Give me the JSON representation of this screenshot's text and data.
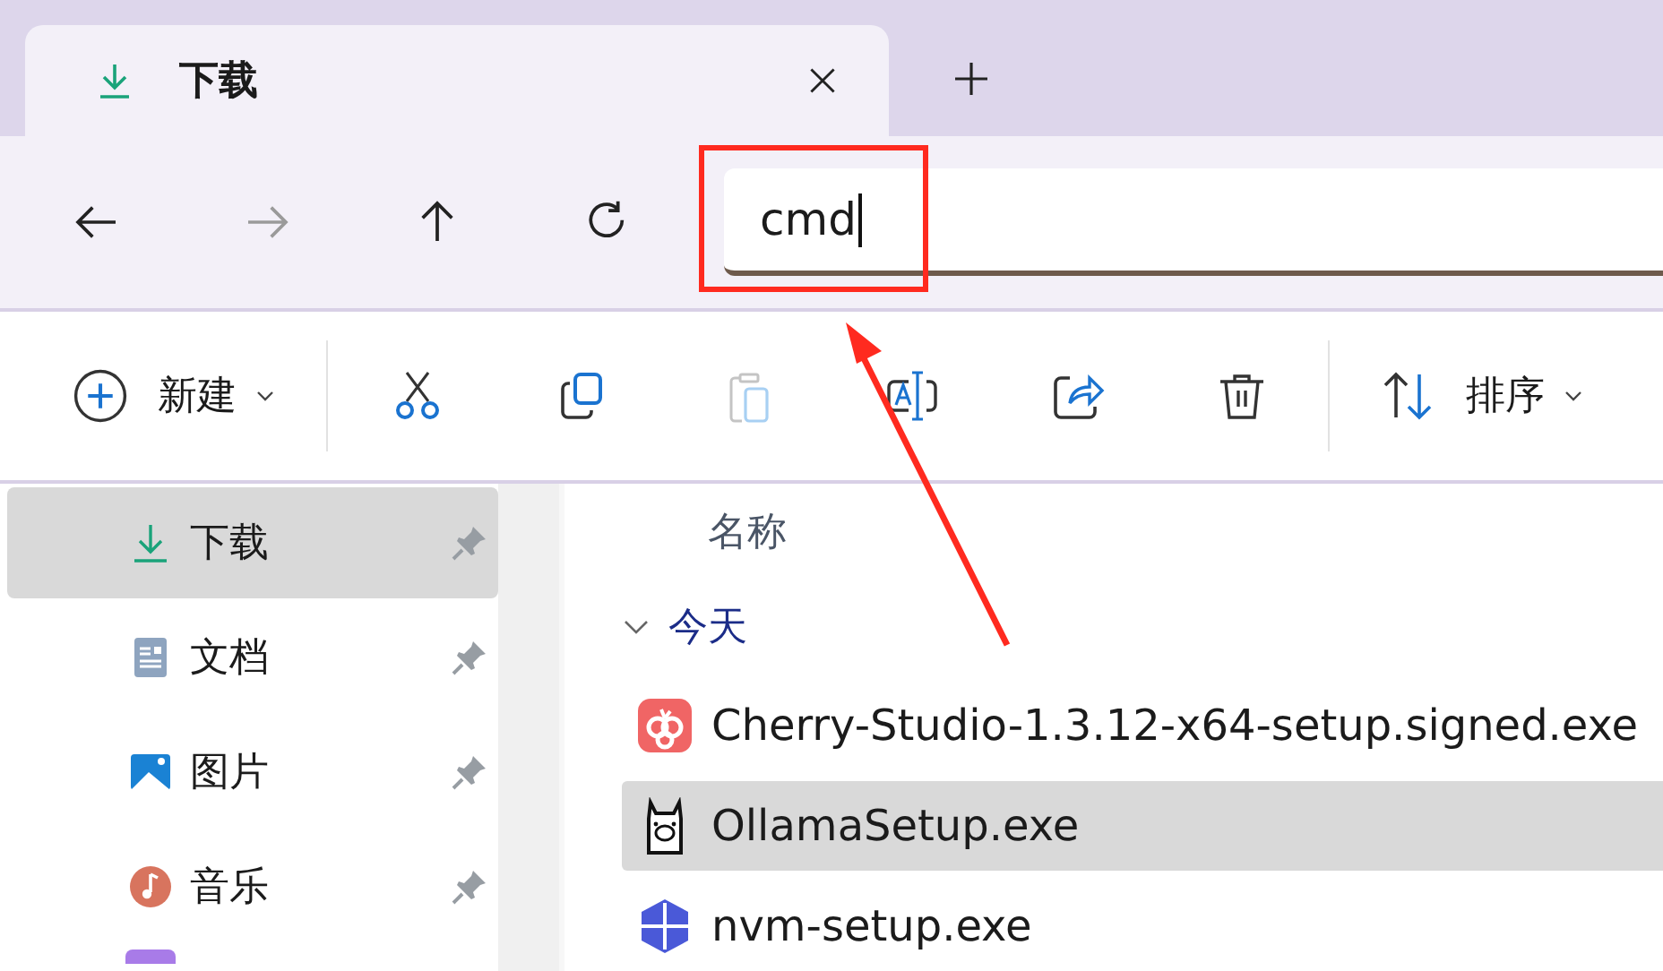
{
  "tabs": [
    {
      "label": "下载",
      "selected": true
    }
  ],
  "nav_buttons": [
    {
      "kind": "back",
      "disabled": false
    },
    {
      "kind": "forward",
      "disabled": true
    },
    {
      "kind": "up",
      "disabled": false
    },
    {
      "kind": "refresh",
      "disabled": false
    }
  ],
  "address_bar": {
    "value": "cmd"
  },
  "toolbar": {
    "new_label": "新建",
    "actions": [
      {
        "kind": "cut",
        "disabled": false
      },
      {
        "kind": "copy",
        "disabled": false
      },
      {
        "kind": "paste",
        "disabled": true
      },
      {
        "kind": "rename",
        "disabled": false
      },
      {
        "kind": "share",
        "disabled": false
      },
      {
        "kind": "delete",
        "disabled": false
      }
    ],
    "sort_label": "排序"
  },
  "sidebar": {
    "items": [
      {
        "label": "下载",
        "kind": "downloads",
        "selected": true,
        "pinned": true
      },
      {
        "label": "文档",
        "kind": "documents",
        "selected": false,
        "pinned": true
      },
      {
        "label": "图片",
        "kind": "pictures",
        "selected": false,
        "pinned": true
      },
      {
        "label": "音乐",
        "kind": "music",
        "selected": false,
        "pinned": true
      }
    ]
  },
  "file_list": {
    "column_header": "名称",
    "groups": [
      {
        "label": "今天",
        "expanded": true,
        "files": [
          {
            "name": "Cherry-Studio-1.3.12-x64-setup.signed.exe",
            "kind": "cherry",
            "selected": false
          },
          {
            "name": "OllamaSetup.exe",
            "kind": "llama",
            "selected": true
          },
          {
            "name": "nvm-setup.exe",
            "kind": "nvm",
            "selected": false
          }
        ]
      }
    ]
  }
}
